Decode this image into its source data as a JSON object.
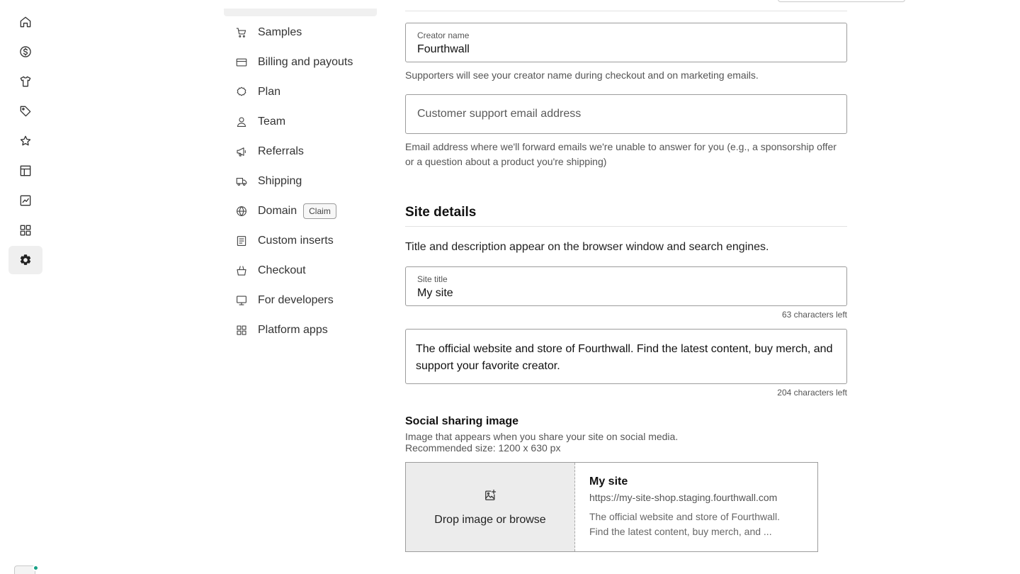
{
  "rail": {
    "items": [
      {
        "icon": "home-icon"
      },
      {
        "icon": "dollar-icon"
      },
      {
        "icon": "tshirt-icon"
      },
      {
        "icon": "tag-icon"
      },
      {
        "icon": "star-icon"
      },
      {
        "icon": "layout-icon"
      },
      {
        "icon": "analytics-icon"
      },
      {
        "icon": "apps-icon"
      },
      {
        "icon": "settings-icon",
        "active": true
      }
    ]
  },
  "settings_nav": {
    "items": [
      {
        "label": "Samples",
        "icon": "cart-icon"
      },
      {
        "label": "Billing and payouts",
        "icon": "credit-card-icon"
      },
      {
        "label": "Plan",
        "icon": "badge-icon"
      },
      {
        "label": "Team",
        "icon": "user-icon"
      },
      {
        "label": "Referrals",
        "icon": "megaphone-icon"
      },
      {
        "label": "Shipping",
        "icon": "truck-icon"
      },
      {
        "label": "Domain",
        "icon": "globe-icon",
        "badge": "Claim"
      },
      {
        "label": "Custom inserts",
        "icon": "document-icon"
      },
      {
        "label": "Checkout",
        "icon": "basket-icon"
      },
      {
        "label": "For developers",
        "icon": "monitor-icon"
      },
      {
        "label": "Platform apps",
        "icon": "grid-icon"
      }
    ]
  },
  "form": {
    "creator_name": {
      "label": "Creator name",
      "value": "Fourthwall",
      "help": "Supporters will see your creator name during checkout and on marketing emails."
    },
    "support_email": {
      "placeholder": "Customer support email address",
      "value": "",
      "help": "Email address where we'll forward emails we're unable to answer for you (e.g., a sponsorship offer or a question about a product you're shipping)"
    }
  },
  "site_details": {
    "title": "Site details",
    "description": "Title and description appear on the browser window and search engines.",
    "site_title": {
      "label": "Site title",
      "value": "My site",
      "count": "63 characters left"
    },
    "site_description": {
      "value": "The official website and store of Fourthwall. Find the latest content, buy merch, and support your favorite creator.",
      "count": "204 characters left"
    },
    "social_image": {
      "title": "Social sharing image",
      "description": "Image that appears when you share your site on social media.",
      "recommended": "Recommended size: 1200 x 630 px",
      "drop_label": "Drop image or browse",
      "preview": {
        "title": "My site",
        "url": "https://my-site-shop.staging.fourthwall.com",
        "description": "The official website and store of Fourthwall. Find the latest content, buy merch, and ..."
      }
    }
  }
}
